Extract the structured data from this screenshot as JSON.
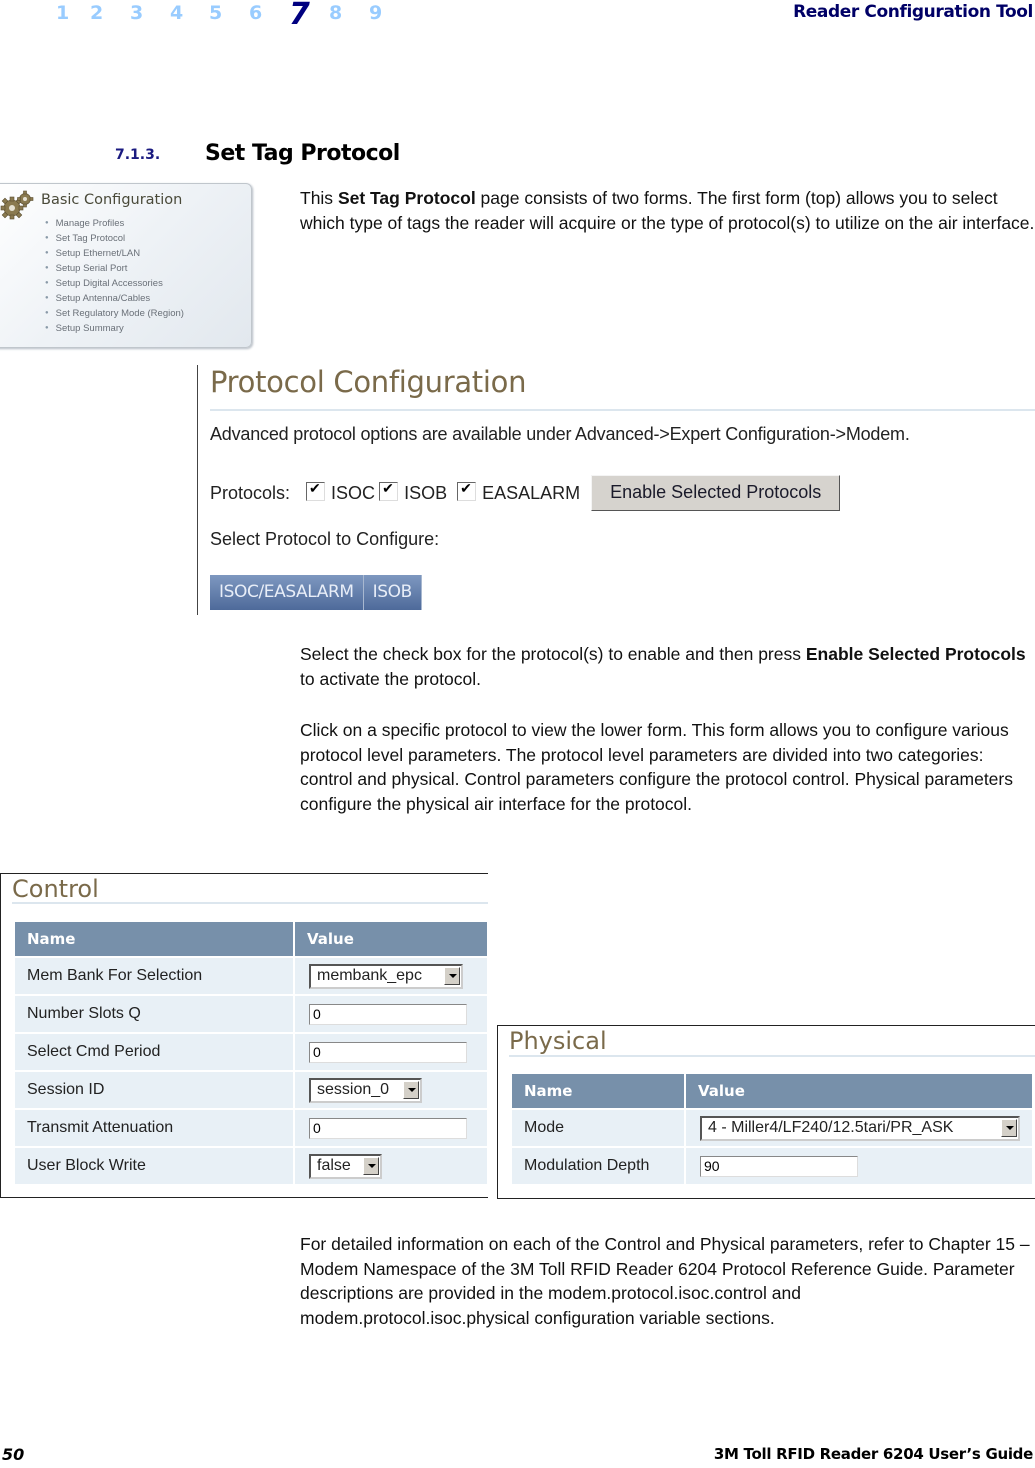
{
  "header": {
    "chapters": [
      "1",
      "2",
      "3",
      "4",
      "5",
      "6",
      "7",
      "8",
      "9"
    ],
    "current_chapter": "7",
    "title": "Reader Configuration Tool"
  },
  "section": {
    "number": "7.1.3.",
    "title": "Set Tag Protocol"
  },
  "basic_config": {
    "title": "Basic Configuration",
    "icon": "gear-icon",
    "items": [
      "Manage Profiles",
      "Set Tag Protocol",
      "Setup Ethernet/LAN",
      "Setup Serial Port",
      "Setup Digital Accessories",
      "Setup Antenna/Cables",
      "Set Regulatory Mode (Region)",
      "Setup Summary"
    ]
  },
  "intro": {
    "prefix": "This ",
    "bold": "Set Tag Protocol",
    "rest": " page consists of two forms. The first form (top) allows you to select which type of tags the reader will acquire or the type of protocol(s) to utilize on the air interface."
  },
  "protocol_config": {
    "title": "Protocol Configuration",
    "advanced_note": "Advanced protocol options are available under Advanced->Expert Configuration->Modem.",
    "protocols_label": "Protocols:",
    "protocols": [
      {
        "label": "ISOC",
        "checked": true
      },
      {
        "label": "ISOB",
        "checked": true
      },
      {
        "label": "EASALARM",
        "checked": true
      }
    ],
    "enable_button": "Enable Selected Protocols",
    "select_label": "Select Protocol to Configure:",
    "tabs": [
      "ISOC/EASALARM",
      "ISOB"
    ]
  },
  "para_enable": {
    "prefix": "Select the check box for the protocol(s) to enable and then press ",
    "bold": "Enable Selected Protocols",
    "rest": " to activate the protocol."
  },
  "para_click": "Click on a specific protocol to view the lower form. This form allows you to configure various protocol level parameters. The protocol level parameters are divided into two categories: control and physical. Control parameters configure the protocol control. Physical parameters configure the physical air interface for the protocol.",
  "control": {
    "title": "Control",
    "headers": [
      "Name",
      "Value"
    ],
    "rows": [
      {
        "name": "Mem Bank For Selection",
        "type": "select",
        "value": "membank_epc"
      },
      {
        "name": "Number Slots Q",
        "type": "text",
        "value": "0"
      },
      {
        "name": "Select Cmd Period",
        "type": "text",
        "value": "0"
      },
      {
        "name": "Session ID",
        "type": "select",
        "value": "session_0"
      },
      {
        "name": "Transmit Attenuation",
        "type": "text",
        "value": "0"
      },
      {
        "name": "User Block Write",
        "type": "select",
        "value": "false"
      }
    ]
  },
  "physical": {
    "title": "Physical",
    "headers": [
      "Name",
      "Value"
    ],
    "rows": [
      {
        "name": "Mode",
        "type": "select",
        "value": "4 - Miller4/LF240/12.5tari/PR_ASK"
      },
      {
        "name": "Modulation Depth",
        "type": "text",
        "value": "90"
      }
    ]
  },
  "para_detail": "For detailed information on each of the Control and Physical parameters, refer to Chapter 15 – Modem Namespace of the 3M Toll RFID Reader 6204 Protocol Reference Guide.  Parameter descriptions are provided in the modem.protocol.isoc.control and modem.protocol.isoc.physical configuration variable sections.",
  "footer": {
    "page_number": "50",
    "title": "3M Toll RFID Reader 6204 User’s Guide"
  },
  "colors": {
    "chapter_inactive": "#99ccff",
    "chapter_active": "#000080",
    "panel_title": "#7a6a4a",
    "table_header": "#7790aa",
    "table_cell": "#e8f0f6",
    "tab_bg": "#5f7aa8"
  }
}
